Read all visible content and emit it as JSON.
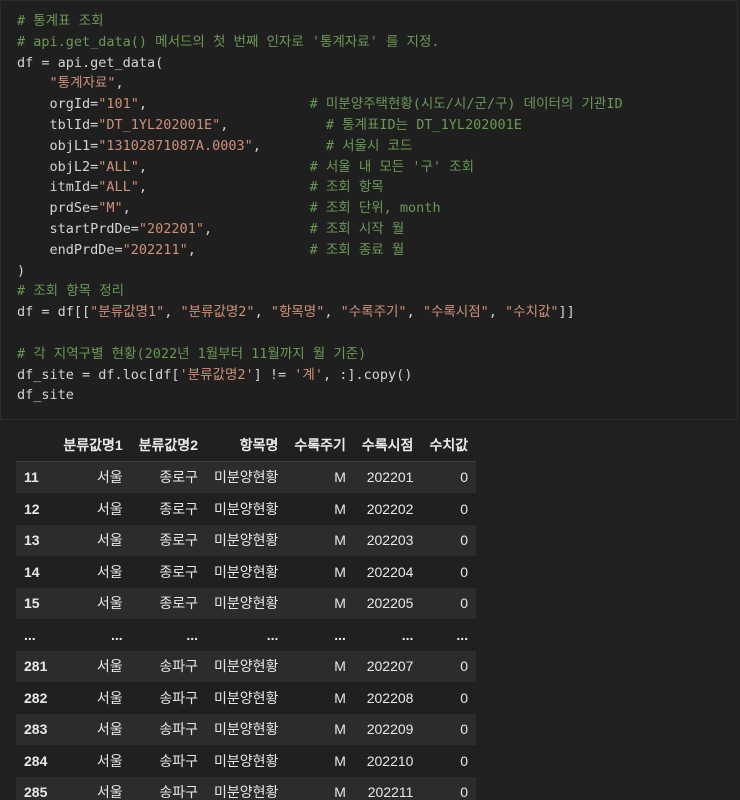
{
  "code_cell": {
    "lines": [
      [
        {
          "t": "comment",
          "s": "# 통계표 조회"
        }
      ],
      [
        {
          "t": "comment",
          "s": "# api.get_data() 메서드의 첫 번째 인자로 '통계자료' 를 지정."
        }
      ],
      [
        {
          "t": "default",
          "s": "df = api.get_data("
        }
      ],
      [
        {
          "t": "default",
          "s": "    "
        },
        {
          "t": "string",
          "s": "\"통계자료\""
        },
        {
          "t": "default",
          "s": ","
        }
      ],
      [
        {
          "t": "default",
          "s": "    orgId="
        },
        {
          "t": "string",
          "s": "\"101\""
        },
        {
          "t": "default",
          "s": ",                    "
        },
        {
          "t": "comment",
          "s": "# 미분양주택현황(시도/시/군/구) 데이터의 기관ID"
        }
      ],
      [
        {
          "t": "default",
          "s": "    tblId="
        },
        {
          "t": "string",
          "s": "\"DT_1YL202001E\""
        },
        {
          "t": "default",
          "s": ",            "
        },
        {
          "t": "comment",
          "s": "# 통계표ID는 DT_1YL202001E"
        }
      ],
      [
        {
          "t": "default",
          "s": "    objL1="
        },
        {
          "t": "string",
          "s": "\"13102871087A.0003\""
        },
        {
          "t": "default",
          "s": ",        "
        },
        {
          "t": "comment",
          "s": "# 서울시 코드"
        }
      ],
      [
        {
          "t": "default",
          "s": "    objL2="
        },
        {
          "t": "string",
          "s": "\"ALL\""
        },
        {
          "t": "default",
          "s": ",                    "
        },
        {
          "t": "comment",
          "s": "# 서울 내 모든 '구' 조회"
        }
      ],
      [
        {
          "t": "default",
          "s": "    itmId="
        },
        {
          "t": "string",
          "s": "\"ALL\""
        },
        {
          "t": "default",
          "s": ",                    "
        },
        {
          "t": "comment",
          "s": "# 조회 항목"
        }
      ],
      [
        {
          "t": "default",
          "s": "    prdSe="
        },
        {
          "t": "string",
          "s": "\"M\""
        },
        {
          "t": "default",
          "s": ",                      "
        },
        {
          "t": "comment",
          "s": "# 조회 단위, month"
        }
      ],
      [
        {
          "t": "default",
          "s": "    startPrdDe="
        },
        {
          "t": "string",
          "s": "\"202201\""
        },
        {
          "t": "default",
          "s": ",            "
        },
        {
          "t": "comment",
          "s": "# 조회 시작 월"
        }
      ],
      [
        {
          "t": "default",
          "s": "    endPrdDe="
        },
        {
          "t": "string",
          "s": "\"202211\""
        },
        {
          "t": "default",
          "s": ",              "
        },
        {
          "t": "comment",
          "s": "# 조회 종료 월"
        }
      ],
      [
        {
          "t": "default",
          "s": ")"
        }
      ],
      [
        {
          "t": "comment",
          "s": "# 조회 항목 정리"
        }
      ],
      [
        {
          "t": "default",
          "s": "df = df[["
        },
        {
          "t": "string",
          "s": "\"분류값명1\""
        },
        {
          "t": "default",
          "s": ", "
        },
        {
          "t": "string",
          "s": "\"분류값명2\""
        },
        {
          "t": "default",
          "s": ", "
        },
        {
          "t": "string",
          "s": "\"항목명\""
        },
        {
          "t": "default",
          "s": ", "
        },
        {
          "t": "string",
          "s": "\"수록주기\""
        },
        {
          "t": "default",
          "s": ", "
        },
        {
          "t": "string",
          "s": "\"수록시점\""
        },
        {
          "t": "default",
          "s": ", "
        },
        {
          "t": "string",
          "s": "\"수치값\""
        },
        {
          "t": "default",
          "s": "]]"
        }
      ],
      [
        {
          "t": "default",
          "s": ""
        }
      ],
      [
        {
          "t": "comment",
          "s": "# 각 지역구별 현황(2022년 1월부터 11월까지 월 기준)"
        }
      ],
      [
        {
          "t": "default",
          "s": "df_site = df.loc[df["
        },
        {
          "t": "string",
          "s": "'분류값명2'"
        },
        {
          "t": "default",
          "s": "] != "
        },
        {
          "t": "string",
          "s": "'계'"
        },
        {
          "t": "default",
          "s": ", :].copy()"
        }
      ],
      [
        {
          "t": "default",
          "s": "df_site"
        }
      ]
    ]
  },
  "output_table": {
    "columns": [
      "",
      "분류값명1",
      "분류값명2",
      "항목명",
      "수록주기",
      "수록시점",
      "수치값"
    ],
    "rows": [
      [
        "11",
        "서울",
        "종로구",
        "미분양현황",
        "M",
        "202201",
        "0"
      ],
      [
        "12",
        "서울",
        "종로구",
        "미분양현황",
        "M",
        "202202",
        "0"
      ],
      [
        "13",
        "서울",
        "종로구",
        "미분양현황",
        "M",
        "202203",
        "0"
      ],
      [
        "14",
        "서울",
        "종로구",
        "미분양현황",
        "M",
        "202204",
        "0"
      ],
      [
        "15",
        "서울",
        "종로구",
        "미분양현황",
        "M",
        "202205",
        "0"
      ],
      [
        "...",
        "...",
        "...",
        "...",
        "...",
        "...",
        "..."
      ],
      [
        "281",
        "서울",
        "송파구",
        "미분양현황",
        "M",
        "202207",
        "0"
      ],
      [
        "282",
        "서울",
        "송파구",
        "미분양현황",
        "M",
        "202208",
        "0"
      ],
      [
        "283",
        "서울",
        "송파구",
        "미분양현황",
        "M",
        "202209",
        "0"
      ],
      [
        "284",
        "서울",
        "송파구",
        "미분양현황",
        "M",
        "202210",
        "0"
      ],
      [
        "285",
        "서울",
        "송파구",
        "미분양현황",
        "M",
        "202211",
        "0"
      ]
    ]
  },
  "colors": {
    "background": "#1e1e1e",
    "comment": "#6a9955",
    "string": "#ce9178",
    "code_text": "#d4d4d4",
    "table_row_odd": "#2c2c2c",
    "table_row_even": "#202020"
  }
}
